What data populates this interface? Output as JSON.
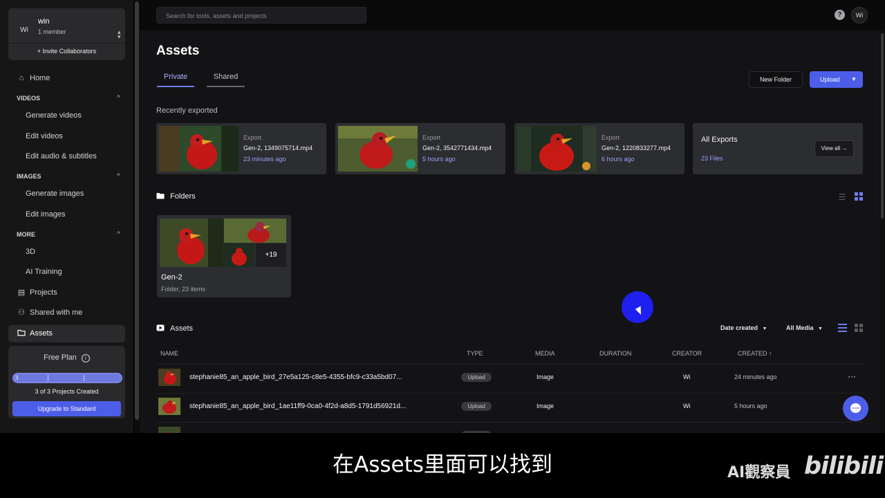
{
  "team": {
    "avatar": "Wi",
    "name": "win",
    "members": "1 member",
    "invite": "+ Invite Collaborators"
  },
  "nav": {
    "home": "Home",
    "videos_section": "VIDEOS",
    "generate_videos": "Generate videos",
    "edit_videos": "Edit videos",
    "edit_audio": "Edit audio & subtitles",
    "images_section": "IMAGES",
    "generate_images": "Generate images",
    "edit_images": "Edit images",
    "more_section": "MORE",
    "three_d": "3D",
    "ai_training": "AI Training",
    "projects": "Projects",
    "shared": "Shared with me",
    "assets": "Assets"
  },
  "plan": {
    "name": "Free Plan",
    "progress_number": "3",
    "progress_fraction": 1.0,
    "count": "3 of 3 Projects Created",
    "upgrade": "Upgrade to Standard"
  },
  "topbar": {
    "search_placeholder": "Search for tools, assets and projects",
    "help": "?",
    "avatar": "Wi"
  },
  "page": {
    "title": "Assets",
    "tabs": [
      "Private",
      "Shared"
    ],
    "active_tab": "Private",
    "new_folder": "New Folder",
    "upload": "Upload",
    "recent_label": "Recently exported"
  },
  "exports": [
    {
      "kind": "Export",
      "name": "Gen-2, 1349075714.mp4",
      "time": "23 minutes ago"
    },
    {
      "kind": "Export",
      "name": "Gen-2, 3542771434.mp4",
      "time": "5 hours ago"
    },
    {
      "kind": "Export",
      "name": "Gen-2, 1220833277.mp4",
      "time": "6 hours ago"
    }
  ],
  "all_exports": {
    "title": "All Exports",
    "count": "23 Files",
    "view_all": "View all →"
  },
  "folders": {
    "heading": "Folders",
    "items": [
      {
        "name": "Gen-2",
        "meta": "Folder, 23 items",
        "more": "+19"
      }
    ]
  },
  "assets": {
    "heading": "Assets",
    "sort": "Date created",
    "filter": "All Media",
    "columns": {
      "name": "NAME",
      "type": "TYPE",
      "media": "MEDIA",
      "duration": "DURATION",
      "creator": "CREATOR",
      "created": "CREATED ↑"
    },
    "rows": [
      {
        "name": "stephanie85_an_apple_bird_27e5a125-c8e5-4355-bfc9-c33a5bd07...",
        "type": "Upload",
        "media": "Image",
        "creator": "Wi",
        "created": "24 minutes ago",
        "more": "···"
      },
      {
        "name": "stephanie85_an_apple_bird_1ae11ff9-0ca0-4f2d-a8d5-1791d56921d...",
        "type": "Upload",
        "media": "Image",
        "creator": "Wi",
        "created": "5 hours ago"
      }
    ]
  },
  "subtitle": "在Assets里面可以找到",
  "watermark": {
    "text": "AI觀察員",
    "logo": "bilibili"
  },
  "colors": {
    "accent": "#4c5ee8",
    "link": "#98a2f6",
    "background": "#131315",
    "cursor_highlight": "#1f1ff0"
  }
}
